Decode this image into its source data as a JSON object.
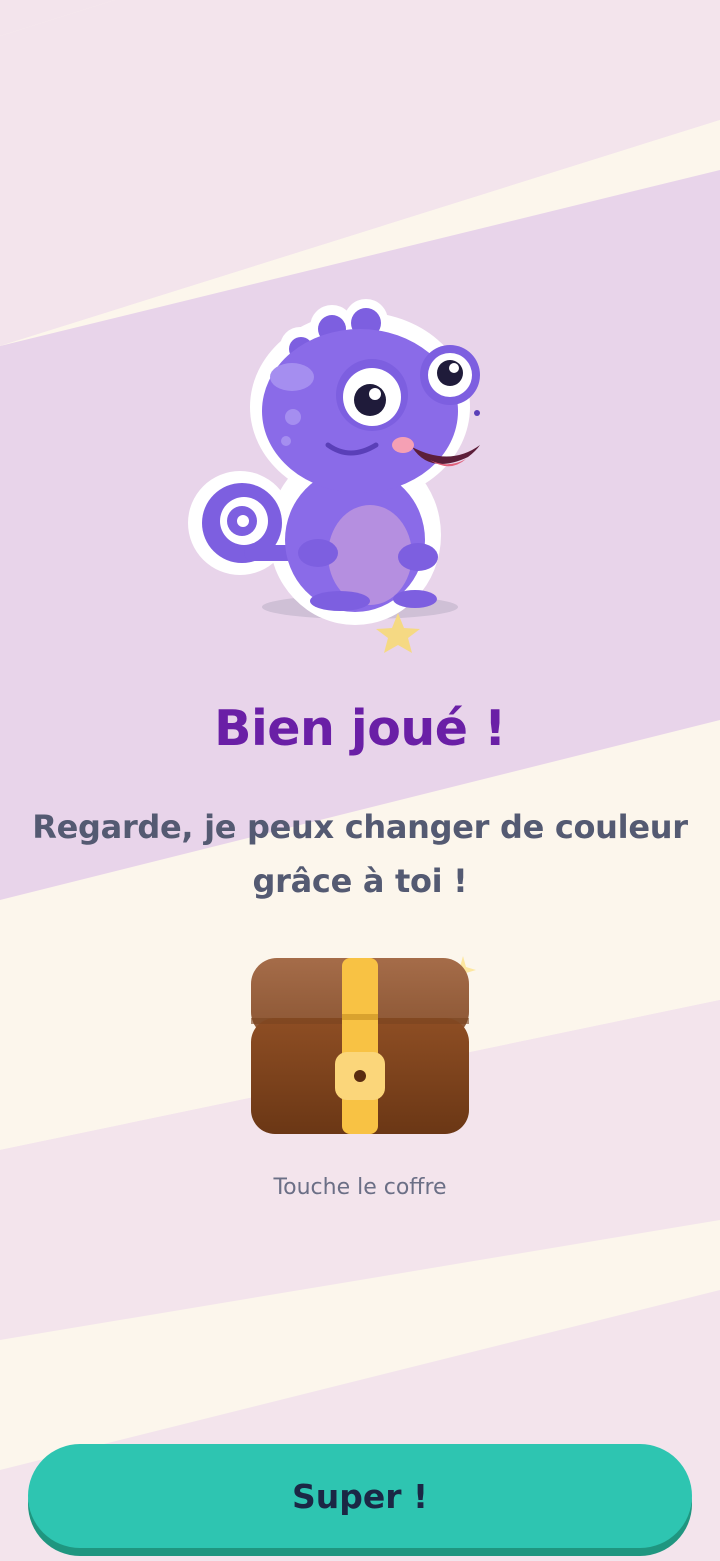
{
  "screen": {
    "title": "Bien joué !",
    "message": "Regarde, je peux changer de couleur grâce à toi !",
    "chest_hint": "Touche le coffre",
    "button_label": "Super !"
  },
  "icons": {
    "mascot": "purple-chameleon-mascot",
    "chest": "treasure-chest-icon",
    "sparkle": "sparkle-star-icon"
  },
  "colors": {
    "title": "#6a1fa6",
    "text": "#545a72",
    "button": "#2ec5b1",
    "button_text": "#1b2745",
    "mascot": "#8a6be8"
  }
}
